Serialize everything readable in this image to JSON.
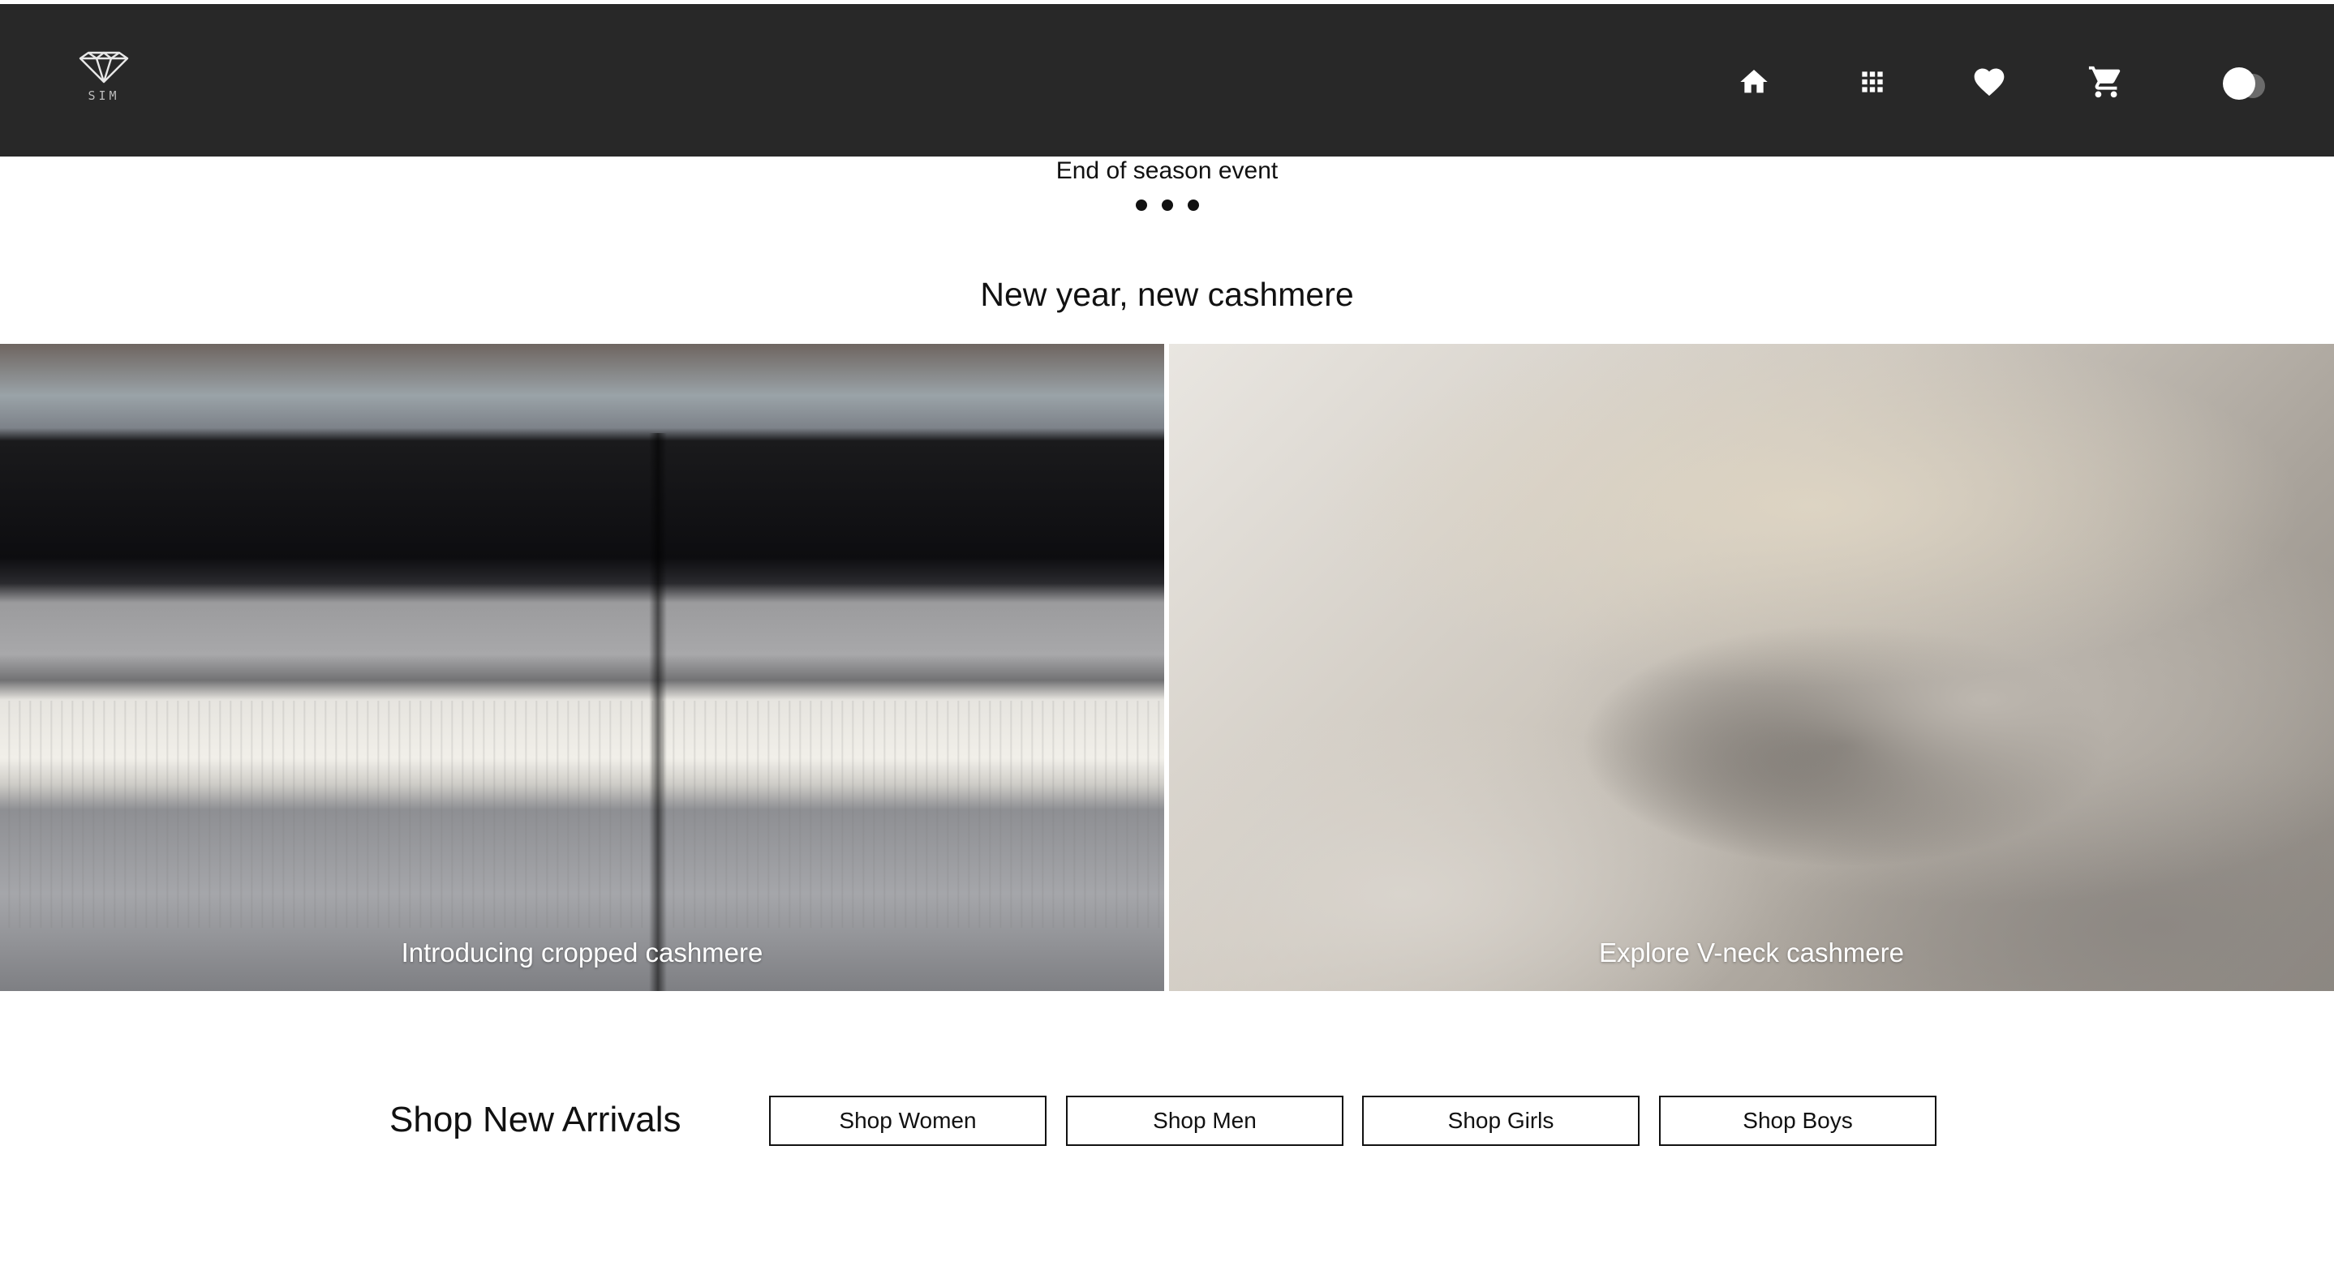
{
  "header": {
    "logo_text": "SIM",
    "nav_icons": [
      "home-icon",
      "grid-icon",
      "heart-icon",
      "cart-icon"
    ],
    "theme_toggle": "theme-toggle"
  },
  "announcement": {
    "text": "End of season event",
    "carousel_dots": 3
  },
  "feature": {
    "title": "New year, new cashmere",
    "cards": [
      {
        "caption": "Introducing cropped cashmere"
      },
      {
        "caption": "Explore V-neck cashmere"
      }
    ]
  },
  "arrivals": {
    "title": "Shop New Arrivals",
    "buttons": [
      "Shop Women",
      "Shop Men",
      "Shop Girls",
      "Shop Boys"
    ]
  },
  "colors": {
    "header_bg": "#282828",
    "page_bg": "#ffffff",
    "text": "#111111"
  }
}
